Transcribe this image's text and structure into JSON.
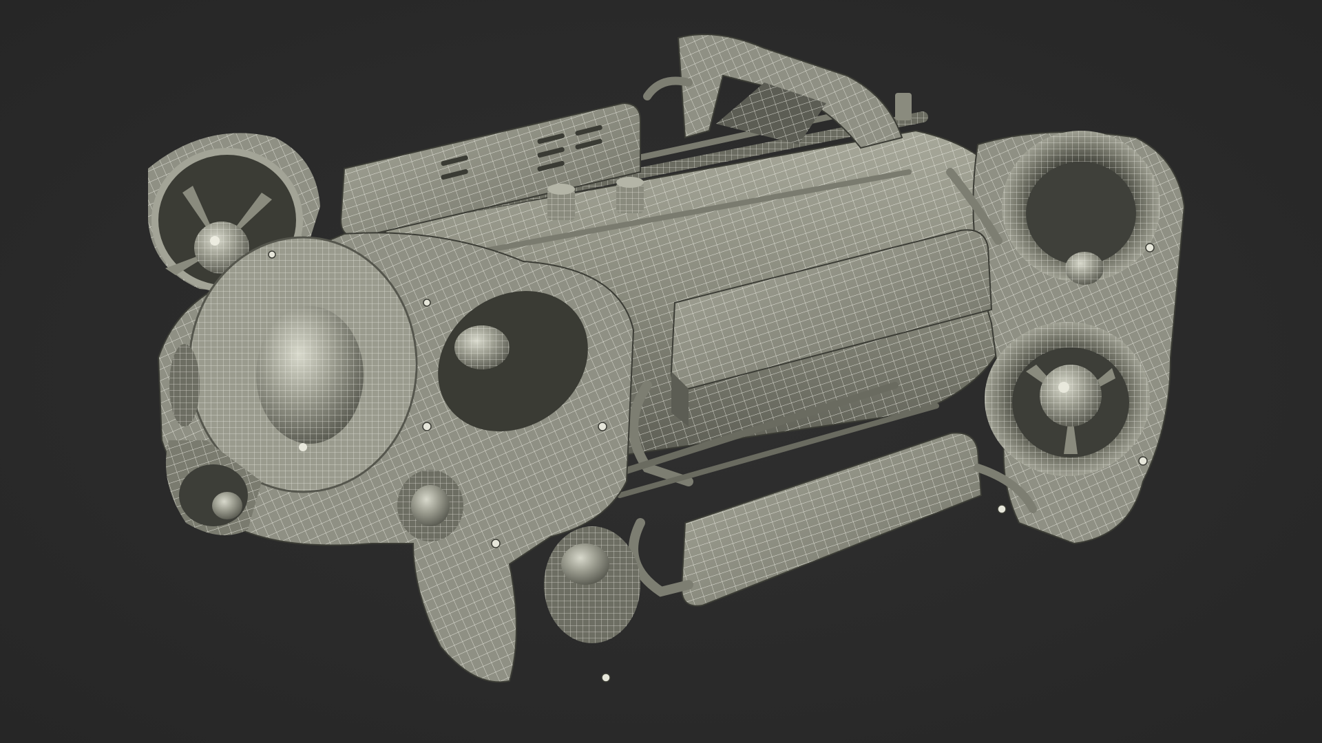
{
  "scene": {
    "subject": "wireframe-3d-model",
    "background_color": "#2b2b2b",
    "body_color": "#8f9084",
    "shadow_color": "#55564d",
    "highlight_color": "#c9cabb",
    "wire_color": "#f2f2ea"
  }
}
